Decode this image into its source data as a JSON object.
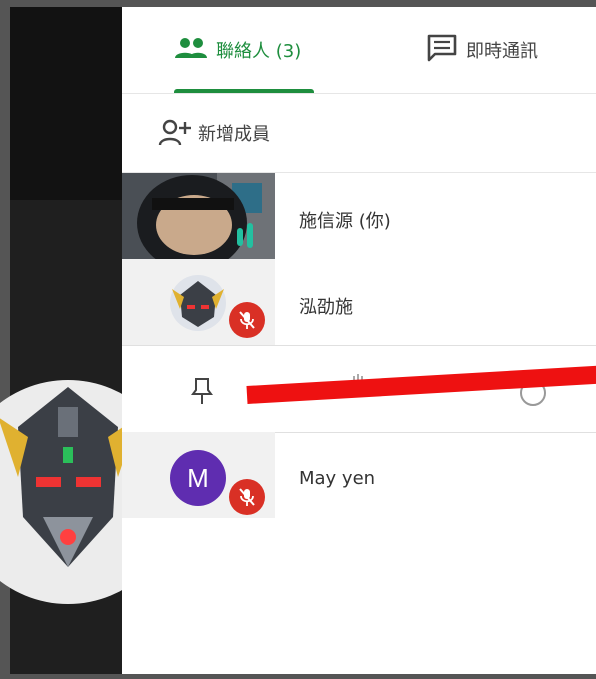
{
  "tabs": [
    {
      "label": "聯絡人 (3)",
      "icon": "people-icon",
      "active": true
    },
    {
      "label": "即時通訊",
      "icon": "chat-icon",
      "active": false
    }
  ],
  "add_member": {
    "label": "新增成員",
    "icon": "person-add-icon"
  },
  "participants": [
    {
      "name": "施信源 (你)",
      "thumb": "helmet-video"
    },
    {
      "name": "泓劭施",
      "thumb": "robot-avatar",
      "muted": true
    },
    {
      "name": "May yen",
      "initial": "M",
      "muted": true
    }
  ],
  "actions": [
    "pin-icon",
    "hand-icon",
    "more-icon"
  ],
  "colors": {
    "accent": "#1e8e3e",
    "mute": "#d93025",
    "avatar_m": "#5f2db0",
    "annotation": "#ee1111"
  }
}
